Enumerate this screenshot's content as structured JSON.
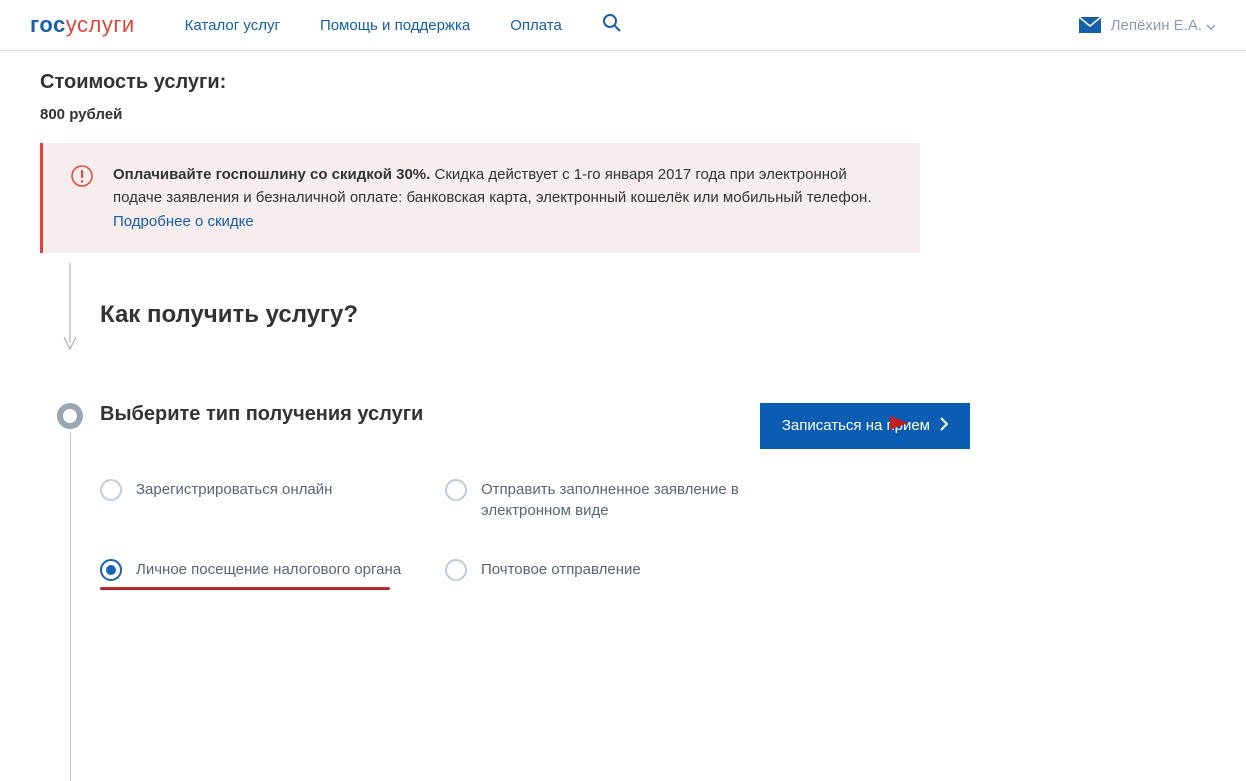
{
  "header": {
    "logo": {
      "gos": "гос",
      "uslugi": "услуги"
    },
    "nav": {
      "catalog": "Каталог услуг",
      "help": "Помощь и поддержка",
      "payment": "Оплата"
    },
    "user": "Лепёхин Е.А."
  },
  "price": {
    "heading": "Стоимость услуги:",
    "value": "800 рублей"
  },
  "infobox": {
    "bold": "Оплачивайте госпошлину со скидкой 30%.",
    "text": " Скидка действует с 1-го января 2017 года при электронной подаче заявления и безналичной оплате: банковская карта, электронный кошелёк или мобильный телефон. ",
    "link": "Подробнее о скидке"
  },
  "how_heading": "Как получить услугу?",
  "step": {
    "title": "Выберите тип получения услуги",
    "button": "Записаться на прием",
    "radios": {
      "online": "Зарегистрироваться онлайн",
      "send": "Отправить заполненное заявление в электронном виде",
      "personal": "Личное посещение налогового органа",
      "postal": "Почтовое отправление"
    }
  },
  "colors": {
    "brand_blue": "#1560a8",
    "brand_red": "#e2453c",
    "button_blue": "#0a5db3"
  }
}
